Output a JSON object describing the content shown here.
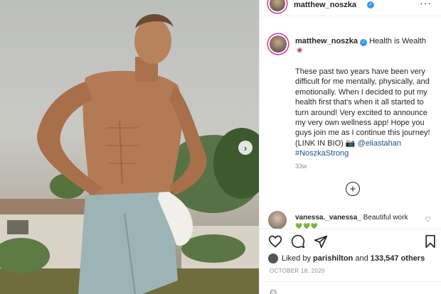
{
  "post": {
    "username": "matthew_noszka",
    "verified": true,
    "caption_title": "Health is Wealth",
    "caption_emoji": "rose",
    "caption_text": "These past two years have been very difficult for me mentally, physically, and emotionally. When I decided to put my health first that's when it all started to turn around! Very excited to announce my very own wellness app! Hope you guys join me as I continue this journey! (LINK IN BIO) 📷",
    "caption_mention": "@eliastahan",
    "caption_hashtag": "#NoszkaStrong",
    "age": "33w"
  },
  "comment": {
    "username": "vanessa._vanessa_",
    "text": "Beautiful work",
    "emojis": "💚💚💚"
  },
  "likes": {
    "prefix": "Liked by",
    "first_user": "parishilton",
    "joiner": "and",
    "count_text": "133,547 others"
  },
  "date": "OCTOBER 18, 2020",
  "icons": {
    "more": "more-horizontal-icon",
    "next": "chevron-right-icon",
    "load_more": "plus-circle-icon",
    "like": "heart-icon",
    "comment": "comment-icon",
    "share": "send-icon",
    "save": "bookmark-icon"
  },
  "colors": {
    "verified": "#3897f0",
    "link": "#1e4e8c",
    "muted": "#8e8e8e",
    "story_ring": "#d6249f"
  }
}
